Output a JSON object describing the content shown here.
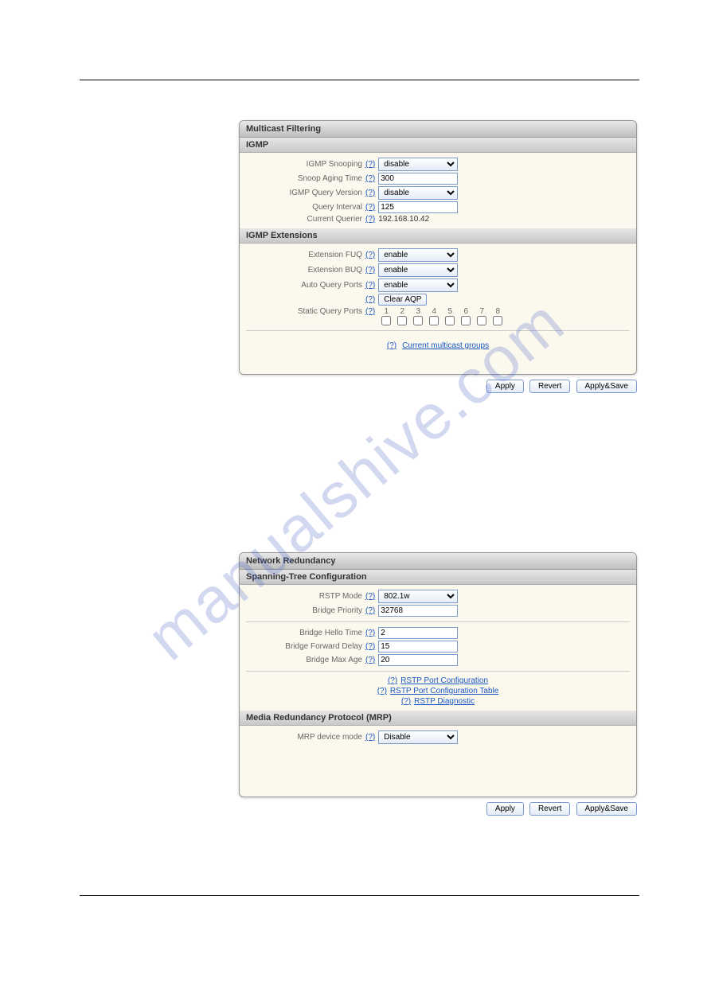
{
  "watermark": "manualshive.com",
  "panel1": {
    "title": "Multicast Filtering",
    "s1_title": "IGMP",
    "igmp_snooping_label": "IGMP Snooping",
    "igmp_snooping_value": "disable",
    "snoop_aging_label": "Snoop Aging Time",
    "snoop_aging_value": "300",
    "igmp_query_version_label": "IGMP Query Version",
    "igmp_query_version_value": "disable",
    "query_interval_label": "Query Interval",
    "query_interval_value": "125",
    "current_querier_label": "Current Querier",
    "current_querier_value": "192.168.10.42",
    "s2_title": "IGMP Extensions",
    "ext_fuq_label": "Extension FUQ",
    "ext_fuq_value": "enable",
    "ext_buq_label": "Extension BUQ",
    "ext_buq_value": "enable",
    "auto_query_label": "Auto Query Ports",
    "auto_query_value": "enable",
    "clear_aqp_label": "Clear AQP",
    "static_query_label": "Static Query Ports",
    "ports": [
      "1",
      "2",
      "3",
      "4",
      "5",
      "6",
      "7",
      "8"
    ],
    "multicast_link": "Current multicast groups",
    "help": "(?)"
  },
  "panel2": {
    "title": "Network Redundancy",
    "s1_title": "Spanning-Tree Configuration",
    "rstp_mode_label": "RSTP Mode",
    "rstp_mode_value": "802.1w",
    "bridge_priority_label": "Bridge Priority",
    "bridge_priority_value": "32768",
    "bridge_hello_label": "Bridge Hello Time",
    "bridge_hello_value": "2",
    "bridge_forward_label": "Bridge Forward Delay",
    "bridge_forward_value": "15",
    "bridge_maxage_label": "Bridge Max Age",
    "bridge_maxage_value": "20",
    "link1": "RSTP Port Configuration",
    "link2": "RSTP Port Configuration Table",
    "link3": "RSTP Diagnostic",
    "s2_title": "Media Redundancy Protocol (MRP)",
    "mrp_mode_label": "MRP device mode",
    "mrp_mode_value": "Disable",
    "help": "(?)"
  },
  "buttons": {
    "apply": "Apply",
    "revert": "Revert",
    "applysave": "Apply&Save"
  }
}
